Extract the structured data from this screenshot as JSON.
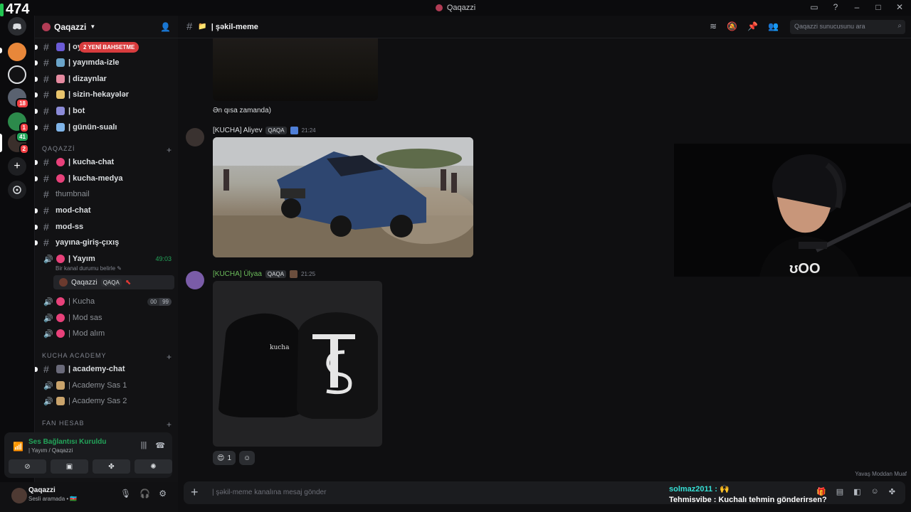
{
  "window": {
    "title": "Qaqazzi",
    "controls": [
      "▭",
      "?",
      "–",
      "□",
      "✕"
    ]
  },
  "overlay_counter": "474",
  "rail": {
    "badges": [
      "18",
      "1",
      "41",
      "2"
    ]
  },
  "server": {
    "name": "Qaqazzi",
    "new_mentions_pill": "2 YENİ BAHSETME"
  },
  "channels_top": [
    {
      "name": "| oy",
      "emoji_color": "#6b5bd6"
    },
    {
      "name": "| yayımda-izle",
      "emoji_color": "#6aa4c9"
    },
    {
      "name": "| dizaynlar",
      "emoji_color": "#e58aa0"
    },
    {
      "name": "| sizin-hekayələr",
      "emoji_color": "#e8c46c"
    },
    {
      "name": "| bot",
      "emoji_color": "#8b8bd8"
    },
    {
      "name": "| günün-sualı",
      "emoji_color": "#7fb4e8"
    }
  ],
  "category_qaqazzi": "QAQAZZİ",
  "channels_qaqazzi": [
    {
      "name": "| kucha-chat"
    },
    {
      "name": "| kucha-medya"
    },
    {
      "name": "thumbnail"
    },
    {
      "name": "mod-chat"
    },
    {
      "name": "mod-ss"
    },
    {
      "name": "yayına-giriş-çıxış"
    }
  ],
  "voice_yayim": {
    "name": "| Yayım",
    "time": "49:03",
    "status_hint": "Bir kanal durumu belirle ✎",
    "user": "Qaqazzi",
    "user_tag": "QAQA"
  },
  "voice_others": [
    {
      "name": "| Kucha",
      "count_left": "00",
      "count_right": "99"
    },
    {
      "name": "| Mod sas"
    },
    {
      "name": "| Mod alım"
    }
  ],
  "category_academy": "KUCHA ACADEMY",
  "channels_academy": [
    {
      "name": "| academy-chat"
    },
    {
      "name": "| Academy Sas 1"
    },
    {
      "name": "| Academy Sas 2"
    }
  ],
  "category_fan": "FAN HESAB",
  "voice_panel": {
    "title": "Ses Bağlantısı Kuruldu",
    "subtitle": "| Yayım / Qaqazzi"
  },
  "user_panel": {
    "name": "Qaqazzi",
    "status": "Sesli aramada • 🇦🇿"
  },
  "main": {
    "channel_name": "| şəkil-meme",
    "search_placeholder": "Qaqazzi sunucusunu ara",
    "first_text": "Ən qısa zamanda)",
    "msg1": {
      "author": "[KUCHA] Aliyev",
      "tag": "QAQA",
      "time": "21:24"
    },
    "msg2": {
      "author": "[KUCHA] Ülyaa",
      "tag": "QAQA",
      "time": "21:25"
    },
    "sweater_print": "kucha",
    "reaction_emoji": "😍",
    "reaction_count": "1",
    "slowmode": "Yavaş Moddan Muaf",
    "composer_placeholder": "| şəkil-meme kanalına mesaj gönder"
  },
  "stream_chat": {
    "line1_user": "solmaz2011 :",
    "line1_msg": "🙌",
    "line2": "Tehmisvibe : Kuchalı tehmin gönderirsen?"
  },
  "colors": {
    "accent_green": "#23a55a",
    "mention_red": "#d83c3e",
    "chat_user": "#36e0d6"
  }
}
